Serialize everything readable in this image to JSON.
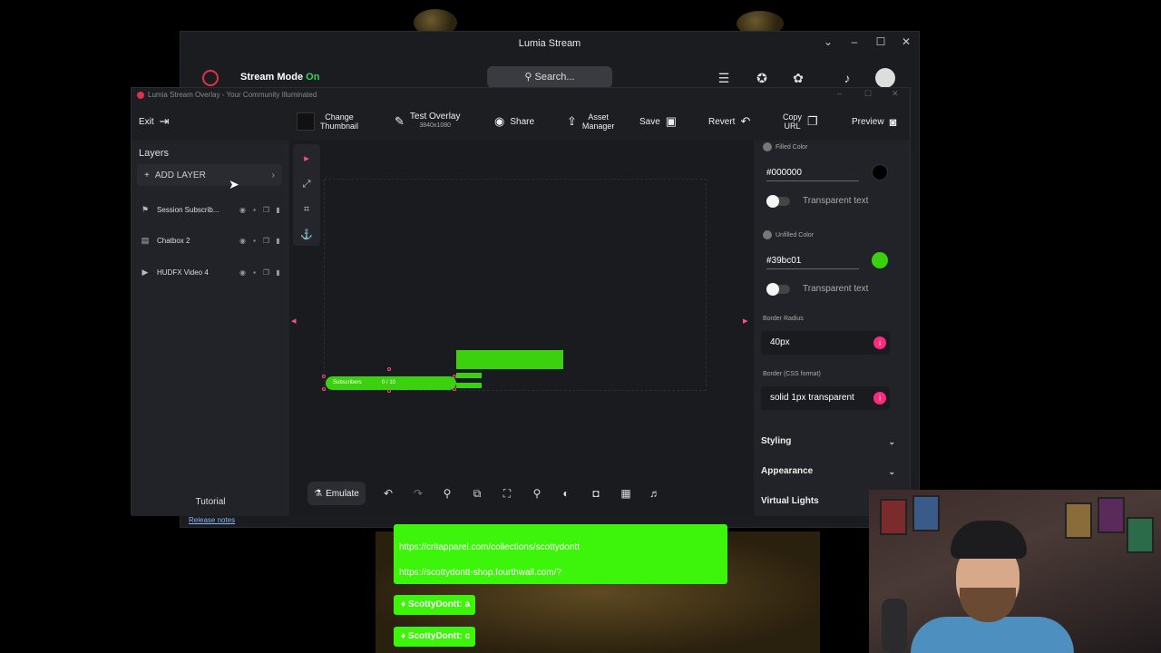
{
  "main_window": {
    "title": "Lumia Stream",
    "stream_mode_label": "Stream Mode",
    "stream_mode_state": "On",
    "search_placeholder": "Search..."
  },
  "overlay_window": {
    "title": "Lumia Stream Overlay - Your Community Illuminated",
    "toolbar": {
      "exit_label": "Exit",
      "change_thumbnail_line1": "Change",
      "change_thumbnail_line2": "Thumbnail",
      "test_overlay_label": "Test Overlay",
      "test_overlay_resolution": "3840x1080",
      "share_label": "Share",
      "asset_manager_line1": "Asset",
      "asset_manager_line2": "Manager",
      "save_label": "Save",
      "revert_label": "Revert",
      "copy_url_line1": "Copy",
      "copy_url_line2": "URL",
      "preview_label": "Preview"
    },
    "layers": {
      "title": "Layers",
      "add_layer_label": "ADD LAYER",
      "items": [
        {
          "name": "Session Subscrib...",
          "icon": "flag-icon"
        },
        {
          "name": "Chatbox 2",
          "icon": "chat-icon"
        },
        {
          "name": "HUDFX Video 4",
          "icon": "video-icon"
        }
      ],
      "tutorial_label": "Tutorial"
    },
    "canvas": {
      "subscribers_label": "Subscribers",
      "subscribers_count": "0 / 10"
    },
    "bottom_toolbar": {
      "emulate_label": "Emulate"
    },
    "properties": {
      "filled_color_caption": "Filled Color",
      "filled_color_value": "#000000",
      "filled_color_swatch": "#000000",
      "transparent_text_label_1": "Transparent text",
      "unfilled_color_caption": "Unfilled Color",
      "unfilled_color_value": "#39bc01",
      "unfilled_color_swatch": "#39d10f",
      "transparent_text_label_2": "Transparent text",
      "border_radius_caption": "Border Radius",
      "border_radius_value": "40px",
      "border_css_caption": "Border (CSS format)",
      "border_css_value": "solid 1px transparent",
      "sections": [
        "Styling",
        "Appearance",
        "Virtual Lights"
      ]
    },
    "release_notes_label": "Release notes"
  },
  "chat_overlay": {
    "links": [
      "https://critapparel.com/collections/scottydontt",
      "https://scottydontt-shop.fourthwall.com/?"
    ],
    "messages": [
      {
        "user": "ScottyDontt:",
        "text": "a"
      },
      {
        "user": "ScottyDontt:",
        "text": "c"
      }
    ]
  },
  "colors": {
    "accent_pink": "#ff2a7f",
    "green": "#3cd10f",
    "panel_bg": "#222328"
  }
}
